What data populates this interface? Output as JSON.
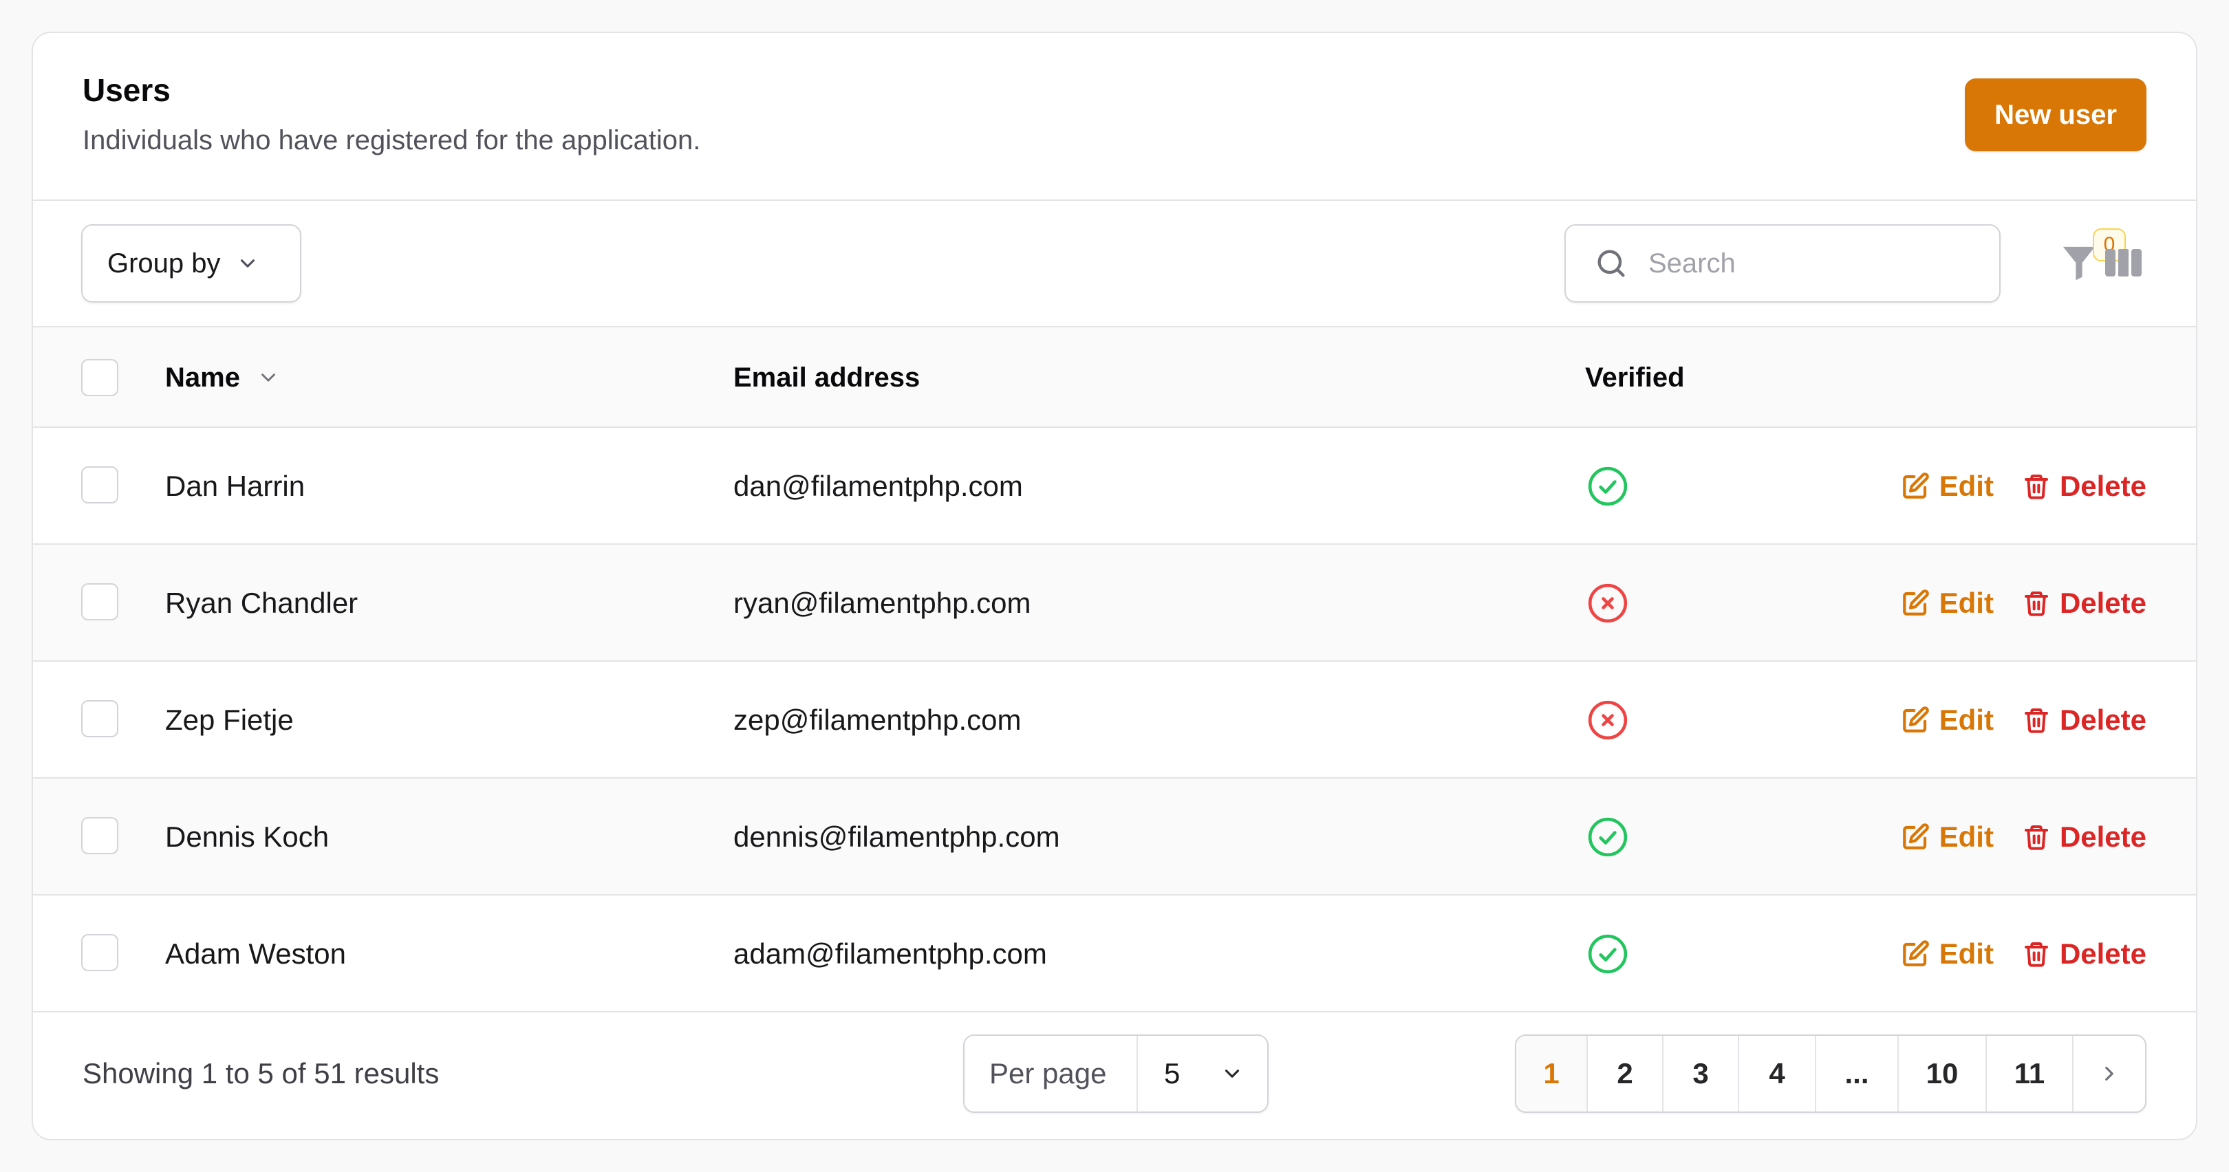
{
  "header": {
    "title": "Users",
    "subtitle": "Individuals who have registered for the application.",
    "new_button": "New user"
  },
  "toolbar": {
    "group_by": "Group by",
    "search_placeholder": "Search",
    "filter_count": "0"
  },
  "table": {
    "columns": {
      "name": "Name",
      "email": "Email address",
      "verified": "Verified"
    },
    "actions": {
      "edit": "Edit",
      "delete": "Delete"
    },
    "rows": [
      {
        "name": "Dan Harrin",
        "email": "dan@filamentphp.com",
        "verified": true
      },
      {
        "name": "Ryan Chandler",
        "email": "ryan@filamentphp.com",
        "verified": false
      },
      {
        "name": "Zep Fietje",
        "email": "zep@filamentphp.com",
        "verified": false
      },
      {
        "name": "Dennis Koch",
        "email": "dennis@filamentphp.com",
        "verified": true
      },
      {
        "name": "Adam Weston",
        "email": "adam@filamentphp.com",
        "verified": true
      }
    ]
  },
  "footer": {
    "showing": "Showing 1 to 5 of 51 results",
    "per_page_label": "Per page",
    "per_page_value": "5",
    "pages": [
      "1",
      "2",
      "3",
      "4",
      "...",
      "10",
      "11"
    ],
    "current_page": "1"
  },
  "colors": {
    "primary": "#d97706",
    "danger": "#dc2626",
    "success": "#22c55e",
    "error": "#ef4444"
  }
}
